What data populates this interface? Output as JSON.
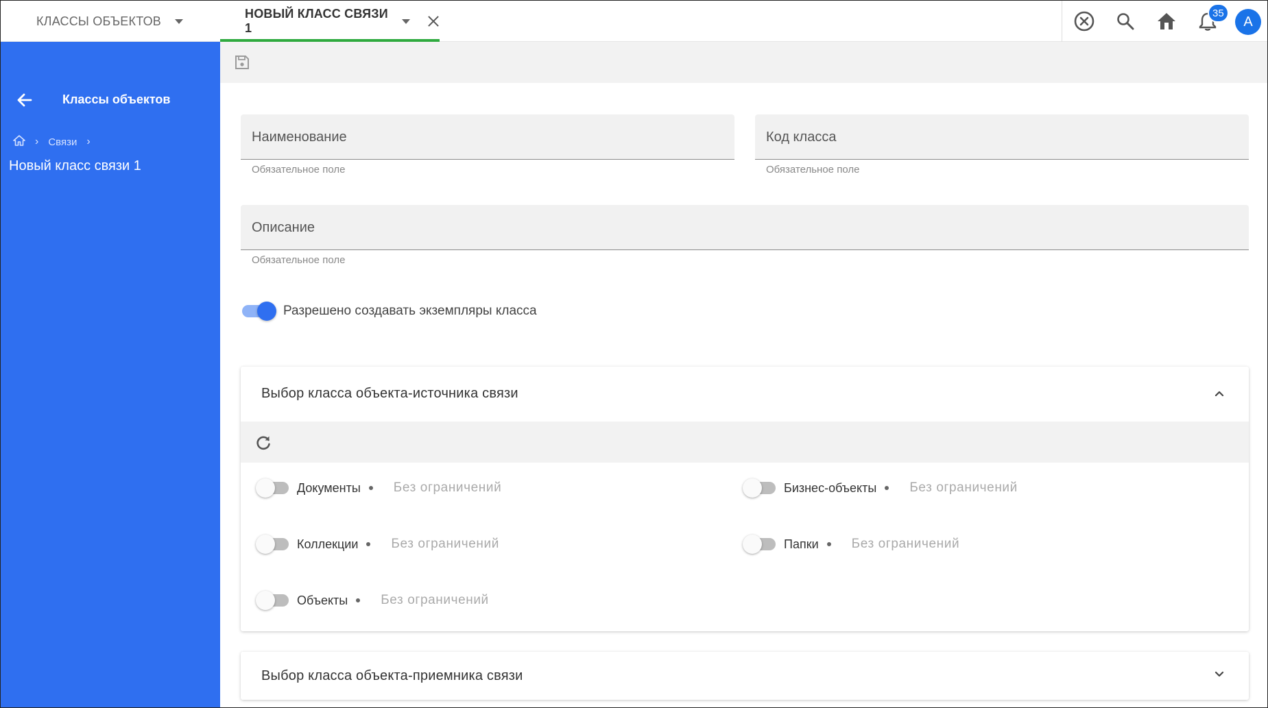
{
  "tabs": [
    {
      "label": "КЛАССЫ ОБЪЕКТОВ"
    },
    {
      "label": "НОВЫЙ КЛАСС СВЯЗИ 1"
    }
  ],
  "header": {
    "notifications_count": "35",
    "avatar_initial": "А"
  },
  "sidebar": {
    "back_label": "Классы объектов",
    "breadcrumb": [
      "Связи"
    ],
    "title": "Новый класс связи 1"
  },
  "form": {
    "name_label": "Наименование",
    "name_hint": "Обязательное поле",
    "code_label": "Код класса",
    "code_hint": "Обязательное поле",
    "desc_label": "Описание",
    "desc_hint": "Обязательное поле",
    "allow_instances_label": "Разрешено создавать экземпляры класса"
  },
  "source_panel": {
    "title": "Выбор класса объекта-источника связи",
    "options": [
      {
        "name": "Документы",
        "value": "Без ограничений"
      },
      {
        "name": "Коллекции",
        "value": "Без ограничений"
      },
      {
        "name": "Объекты",
        "value": "Без ограничений"
      },
      {
        "name": "Бизнес-объекты",
        "value": "Без ограничений"
      },
      {
        "name": "Папки",
        "value": "Без ограничений"
      }
    ]
  },
  "target_panel": {
    "title": "Выбор класса объекта-приемника связи"
  },
  "colors": {
    "sidebar": "#2f6ff0",
    "accent": "#1a73e8",
    "tab_indicator": "#2faa3f"
  }
}
